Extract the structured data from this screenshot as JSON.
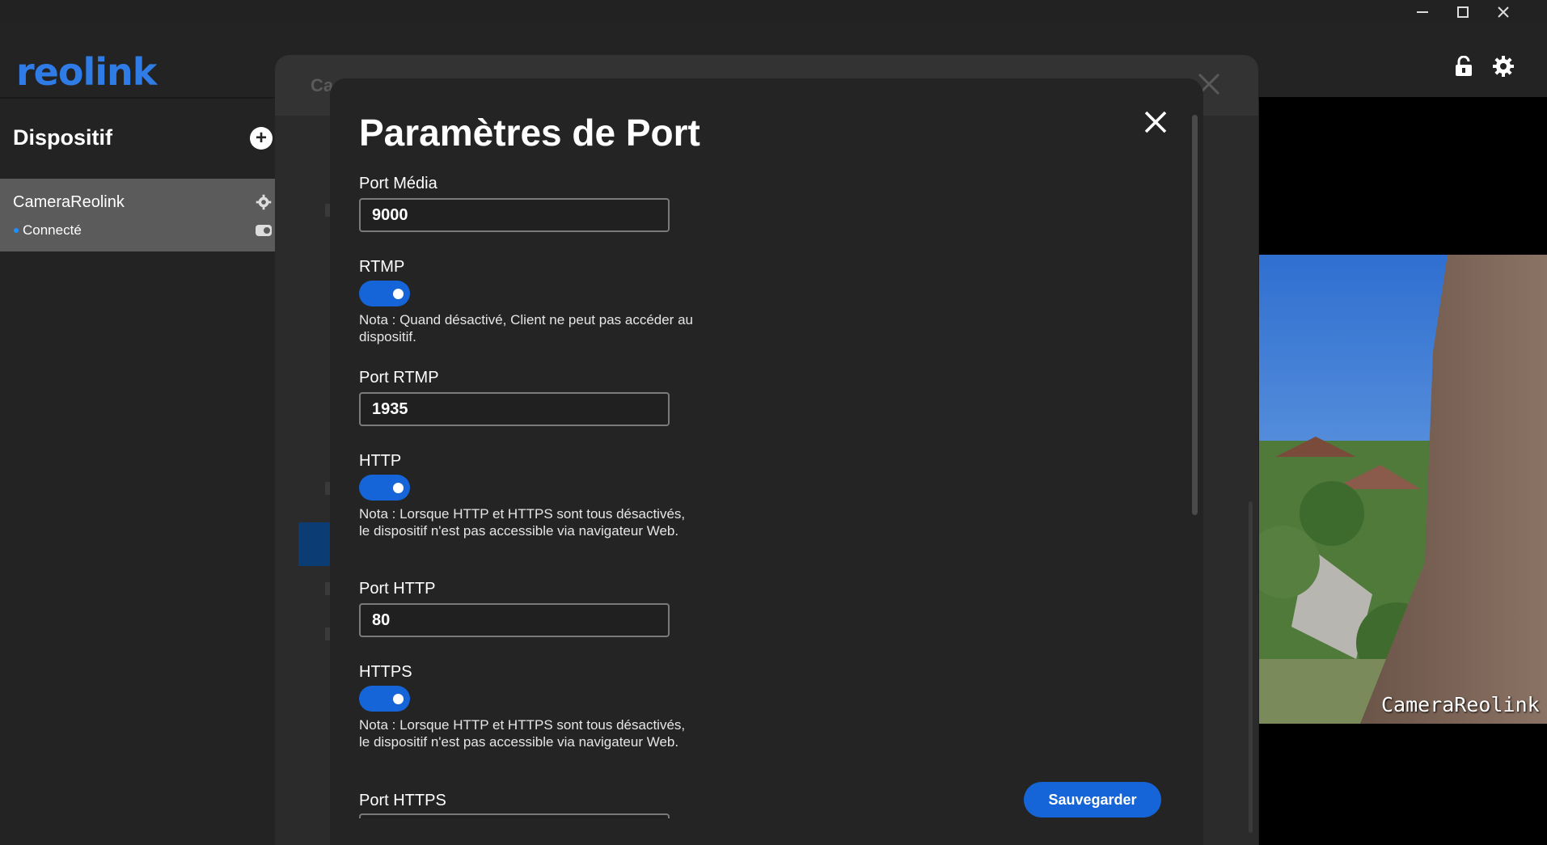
{
  "window": {
    "minimize": "—",
    "maximize": "☐",
    "close": "✕"
  },
  "app": {
    "logo": "reolink"
  },
  "sidebar": {
    "title": "Dispositif",
    "add_symbol": "+",
    "device": {
      "name": "CameraReolink",
      "status": "Connecté"
    }
  },
  "background_dialog": {
    "title": "Ca"
  },
  "video": {
    "overlay_label": "CameraReolink"
  },
  "dialog": {
    "title": "Paramètres de Port",
    "fields": {
      "media_port": {
        "label": "Port Média",
        "value": "9000"
      },
      "rtmp": {
        "label": "RTMP",
        "enabled": true,
        "note": "Nota : Quand désactivé, Client ne peut pas accéder au dispositif."
      },
      "rtmp_port": {
        "label": "Port RTMP",
        "value": "1935"
      },
      "http": {
        "label": "HTTP",
        "enabled": true,
        "note": "Nota : Lorsque HTTP et HTTPS sont tous désactivés, le dispositif n'est pas accessible via navigateur Web."
      },
      "http_port": {
        "label": "Port HTTP",
        "value": "80"
      },
      "https": {
        "label": "HTTPS",
        "enabled": true,
        "note": "Nota : Lorsque HTTP et HTTPS sont tous désactivés, le dispositif n'est pas accessible via navigateur Web."
      },
      "https_port": {
        "label": "Port HTTPS",
        "value": ""
      }
    },
    "save_label": "Sauvegarder"
  },
  "colors": {
    "accent": "#1565d8",
    "logo": "#2f7ce6",
    "background": "#222222",
    "selected_device": "#5b5b5b"
  }
}
